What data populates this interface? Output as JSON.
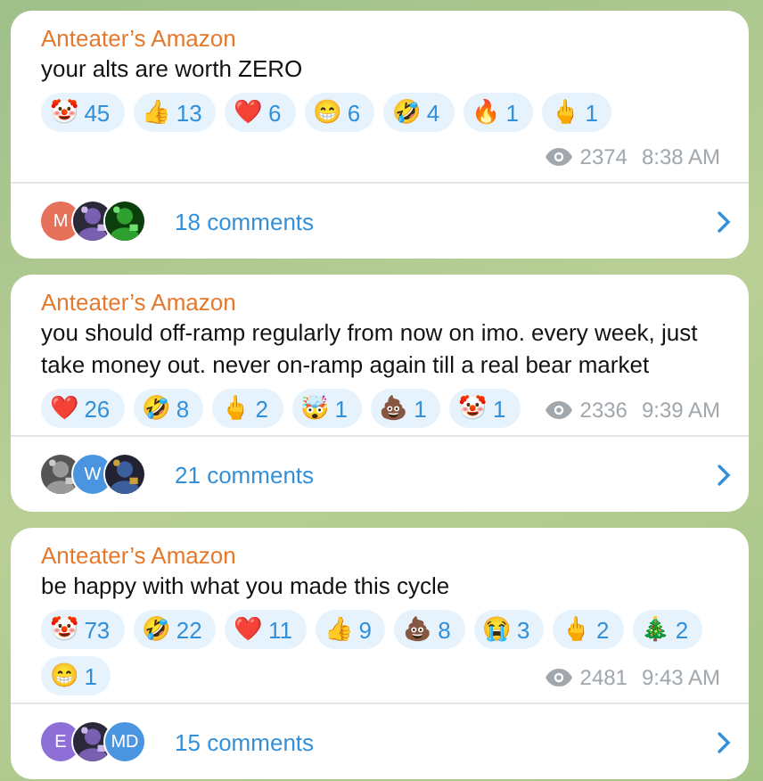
{
  "posts": [
    {
      "author": "Anteater’s Amazon",
      "text": "your alts are worth ZERO",
      "reactions": [
        {
          "emoji": "🤡",
          "count": "45"
        },
        {
          "emoji": "👍",
          "count": "13"
        },
        {
          "emoji": "❤️",
          "count": "6"
        },
        {
          "emoji": "😁",
          "count": "6"
        },
        {
          "emoji": "🤣",
          "count": "4"
        },
        {
          "emoji": "🔥",
          "count": "1"
        },
        {
          "emoji": "🖕",
          "count": "1"
        }
      ],
      "views": "2374",
      "time": "8:38 AM",
      "avatars": [
        {
          "kind": "letter",
          "letter": "M",
          "color": "#e5715a"
        },
        {
          "kind": "picture"
        },
        {
          "kind": "picture"
        }
      ],
      "comments": "18 comments"
    },
    {
      "author": "Anteater’s Amazon",
      "text": "you should off-ramp regularly from now on imo. every week, just take money out. never on-ramp again till a real bear market",
      "reactions": [
        {
          "emoji": "❤️",
          "count": "26"
        },
        {
          "emoji": "🤣",
          "count": "8"
        },
        {
          "emoji": "🖕",
          "count": "2"
        },
        {
          "emoji": "🤯",
          "count": "1"
        },
        {
          "emoji": "💩",
          "count": "1"
        },
        {
          "emoji": "🤡",
          "count": "1"
        }
      ],
      "views": "2336",
      "time": "9:39 AM",
      "avatars": [
        {
          "kind": "picture"
        },
        {
          "kind": "letter",
          "letter": "W",
          "color": "#4a94e0"
        },
        {
          "kind": "picture"
        }
      ],
      "comments": "21 comments"
    },
    {
      "author": "Anteater’s Amazon",
      "text": "be happy with what you made this cycle",
      "reactions": [
        {
          "emoji": "🤡",
          "count": "73"
        },
        {
          "emoji": "🤣",
          "count": "22"
        },
        {
          "emoji": "❤️",
          "count": "11"
        },
        {
          "emoji": "👍",
          "count": "9"
        },
        {
          "emoji": "💩",
          "count": "8"
        },
        {
          "emoji": "😭",
          "count": "3"
        },
        {
          "emoji": "🖕",
          "count": "2"
        },
        {
          "emoji": "🎄",
          "count": "2"
        },
        {
          "emoji": "😁",
          "count": "1"
        }
      ],
      "views": "2481",
      "time": "9:43 AM",
      "avatars": [
        {
          "kind": "letter",
          "letter": "E",
          "color": "#8e6fd8"
        },
        {
          "kind": "picture"
        },
        {
          "kind": "letter",
          "letter": "MD",
          "color": "#4a94e0"
        }
      ],
      "comments": "15 comments"
    }
  ]
}
